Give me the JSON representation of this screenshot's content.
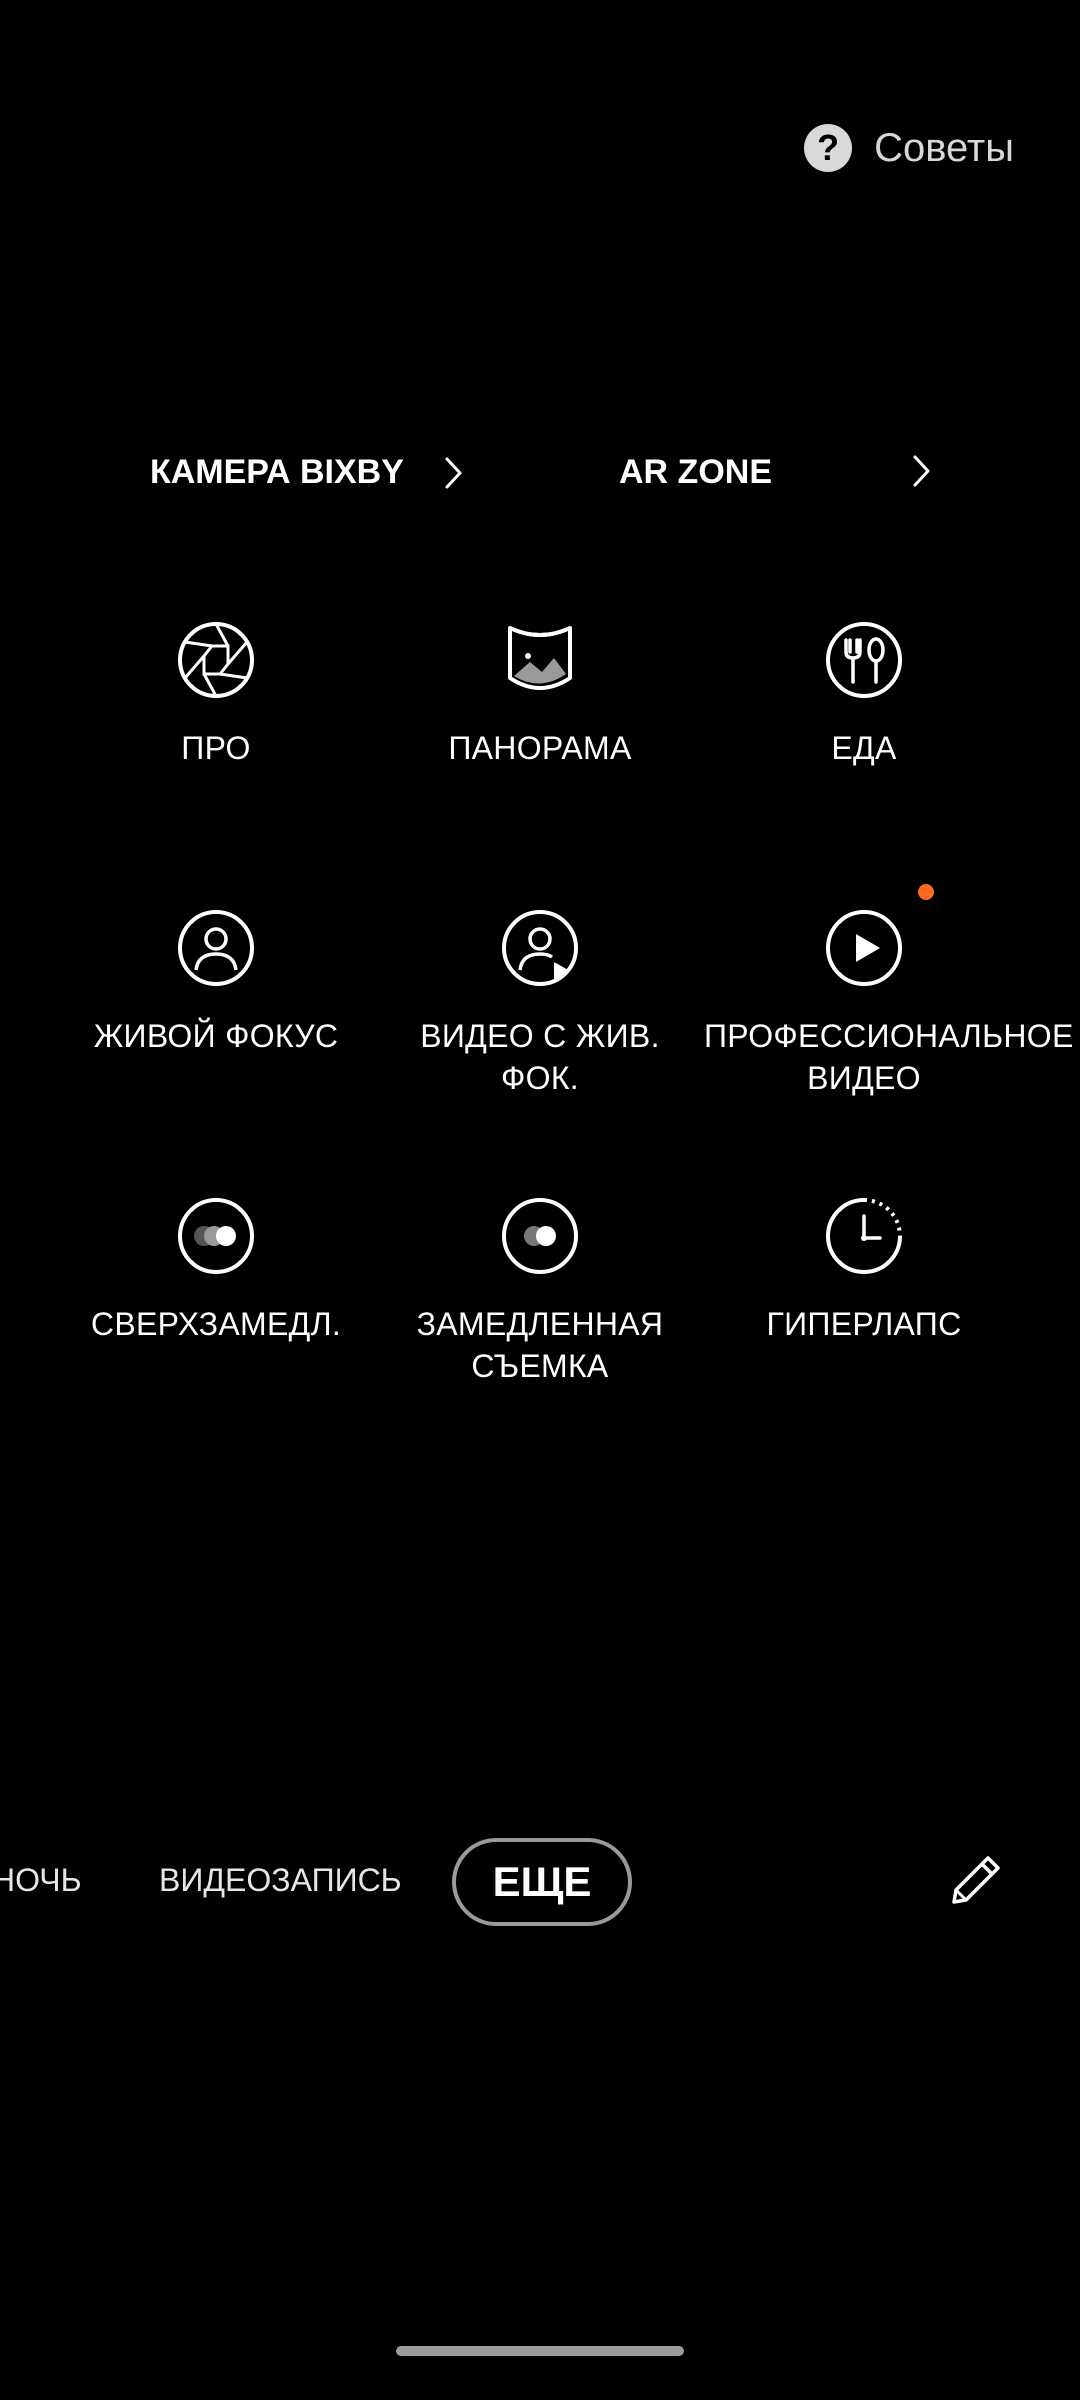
{
  "header": {
    "tips_icon": "question-circle-icon",
    "tips_label": "Советы"
  },
  "links": [
    {
      "label": "КАМЕРА BIXBY",
      "icon": "chevron-right-icon"
    },
    {
      "label": "AR ZONE",
      "icon": "chevron-right-icon"
    }
  ],
  "modes": [
    {
      "label": "ПРО",
      "icon": "aperture-icon"
    },
    {
      "label": "ПАНОРАМА",
      "icon": "panorama-icon"
    },
    {
      "label": "ЕДА",
      "icon": "food-icon"
    },
    {
      "label": "ЖИВОЙ ФОКУС",
      "icon": "portrait-icon"
    },
    {
      "label": "ВИДЕО С ЖИВ. ФОК.",
      "icon": "portrait-video-icon"
    },
    {
      "label": "ПРОФЕССИОНАЛЬНОЕ ВИДЕО",
      "icon": "play-icon",
      "new_badge_color": "#ff6a1a"
    },
    {
      "label": "СВЕРХЗАМЕДЛ.",
      "icon": "super-slow-mo-icon"
    },
    {
      "label": "ЗАМЕДЛЕННАЯ СЪЕМКА",
      "icon": "slow-mo-icon"
    },
    {
      "label": "ГИПЕРЛАПС",
      "icon": "hyperlapse-icon"
    }
  ],
  "tabs": {
    "night": "НОЧЬ",
    "video": "ВИДЕОЗАПИСЬ",
    "more": "ЕЩЕ"
  },
  "edit_icon": "pencil-icon",
  "colors": {
    "background": "#000000",
    "accent_badge": "#ff6a1a"
  }
}
